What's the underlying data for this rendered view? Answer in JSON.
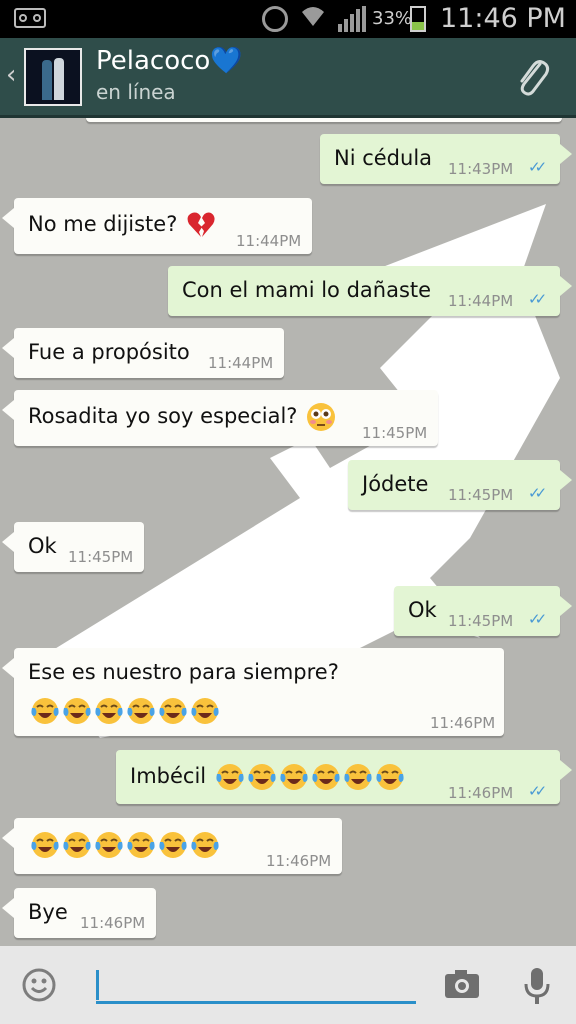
{
  "status_bar": {
    "battery_percent": "33%",
    "time": "11:46 PM",
    "icons": [
      "voicemail-icon",
      "alarm-icon",
      "wifi-icon",
      "signal-icon",
      "battery-icon"
    ]
  },
  "header": {
    "contact_name": "Pelacoco💙",
    "status": "en línea",
    "icons": [
      "back-icon",
      "avatar",
      "paperclip-icon"
    ]
  },
  "messages": [
    {
      "dir": "out",
      "text": "Ni cédula",
      "time": "11:43PM"
    },
    {
      "dir": "in",
      "text": "No me dijiste? ",
      "emoji": "broken-heart",
      "time": "11:44PM"
    },
    {
      "dir": "out",
      "text": "Con el mami lo dañaste",
      "time": "11:44PM"
    },
    {
      "dir": "in",
      "text": "Fue a propósito",
      "time": "11:44PM"
    },
    {
      "dir": "in",
      "text": "Rosadita yo soy especial? ",
      "emoji": "flushed",
      "time": "11:45PM"
    },
    {
      "dir": "out",
      "text": "Jódete",
      "time": "11:45PM"
    },
    {
      "dir": "in",
      "text": "Ok",
      "time": "11:45PM"
    },
    {
      "dir": "out",
      "text": "Ok",
      "time": "11:45PM"
    },
    {
      "dir": "in",
      "text": "Ese es nuestro para siempre?",
      "emoji_count": 6,
      "time": "11:46PM"
    },
    {
      "dir": "out",
      "text": "Imbécil ",
      "emoji_count": 6,
      "time": "11:46PM"
    },
    {
      "dir": "in",
      "text": "",
      "emoji_count": 6,
      "time": "11:46PM"
    },
    {
      "dir": "in",
      "text": "Bye",
      "time": "11:46PM"
    }
  ],
  "read_ticks": "✓✓",
  "input": {
    "placeholder": "",
    "icons": [
      "smiley-icon",
      "camera-icon",
      "microphone-icon"
    ]
  },
  "colors": {
    "header_bg": "#2f4d4a",
    "outgoing_bubble": "#e3f5d4",
    "incoming_bubble": "#fcfcf8",
    "accent": "#2a8fc9"
  }
}
